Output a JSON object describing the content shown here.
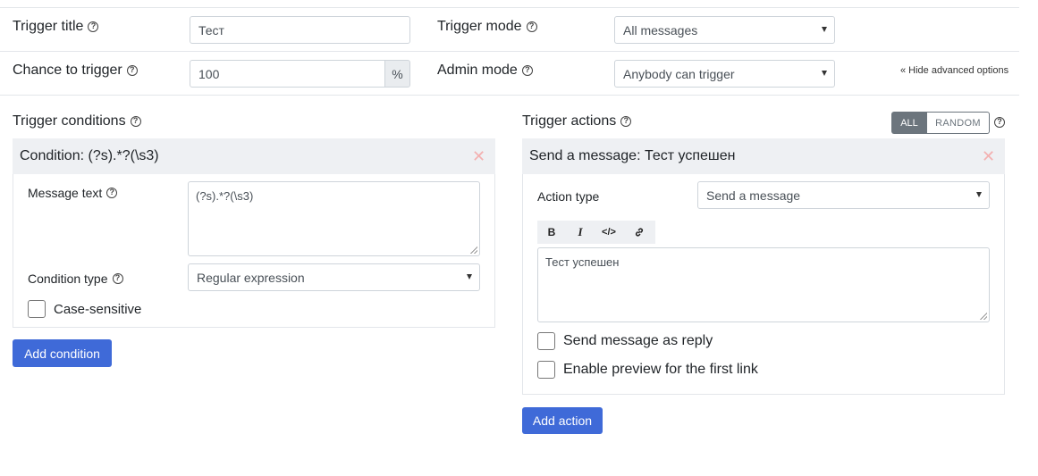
{
  "header": {
    "trigger_title_label": "Trigger title",
    "trigger_title_value": "Тест",
    "trigger_mode_label": "Trigger mode",
    "trigger_mode_value": "All messages",
    "chance_label": "Chance to trigger",
    "chance_value": "100",
    "chance_suffix": "%",
    "admin_mode_label": "Admin mode",
    "admin_mode_value": "Anybody can trigger",
    "hide_advanced": "« Hide advanced options"
  },
  "conditions": {
    "section_label": "Trigger conditions",
    "items": [
      {
        "title": "Condition: (?s).*?(\\s3)",
        "message_text_label": "Message text",
        "message_text_value": "(?s).*?(\\s3)",
        "condition_type_label": "Condition type",
        "condition_type_value": "Regular expression",
        "case_sensitive_label": "Case-sensitive"
      }
    ],
    "add_button": "Add condition"
  },
  "actions": {
    "section_label": "Trigger actions",
    "toggle_all": "ALL",
    "toggle_random": "RANDOM",
    "items": [
      {
        "title": "Send a message: Тест успешен",
        "action_type_label": "Action type",
        "action_type_value": "Send a message",
        "toolbar": {
          "bold": "B",
          "italic": "I",
          "code": "</>"
        },
        "message_value": "Тест успешен",
        "reply_label": "Send message as reply",
        "preview_label": "Enable preview for the first link"
      }
    ],
    "add_button": "Add action"
  },
  "icons": {
    "help": "question-circle-icon",
    "close": "close-x-icon",
    "caret": "caret-down-icon",
    "link": "link-icon"
  },
  "colors": {
    "primary": "#3f6ad8",
    "panel_header": "#eef0f3",
    "close": "#f3b0b0",
    "toggle_active": "#6c757d"
  }
}
